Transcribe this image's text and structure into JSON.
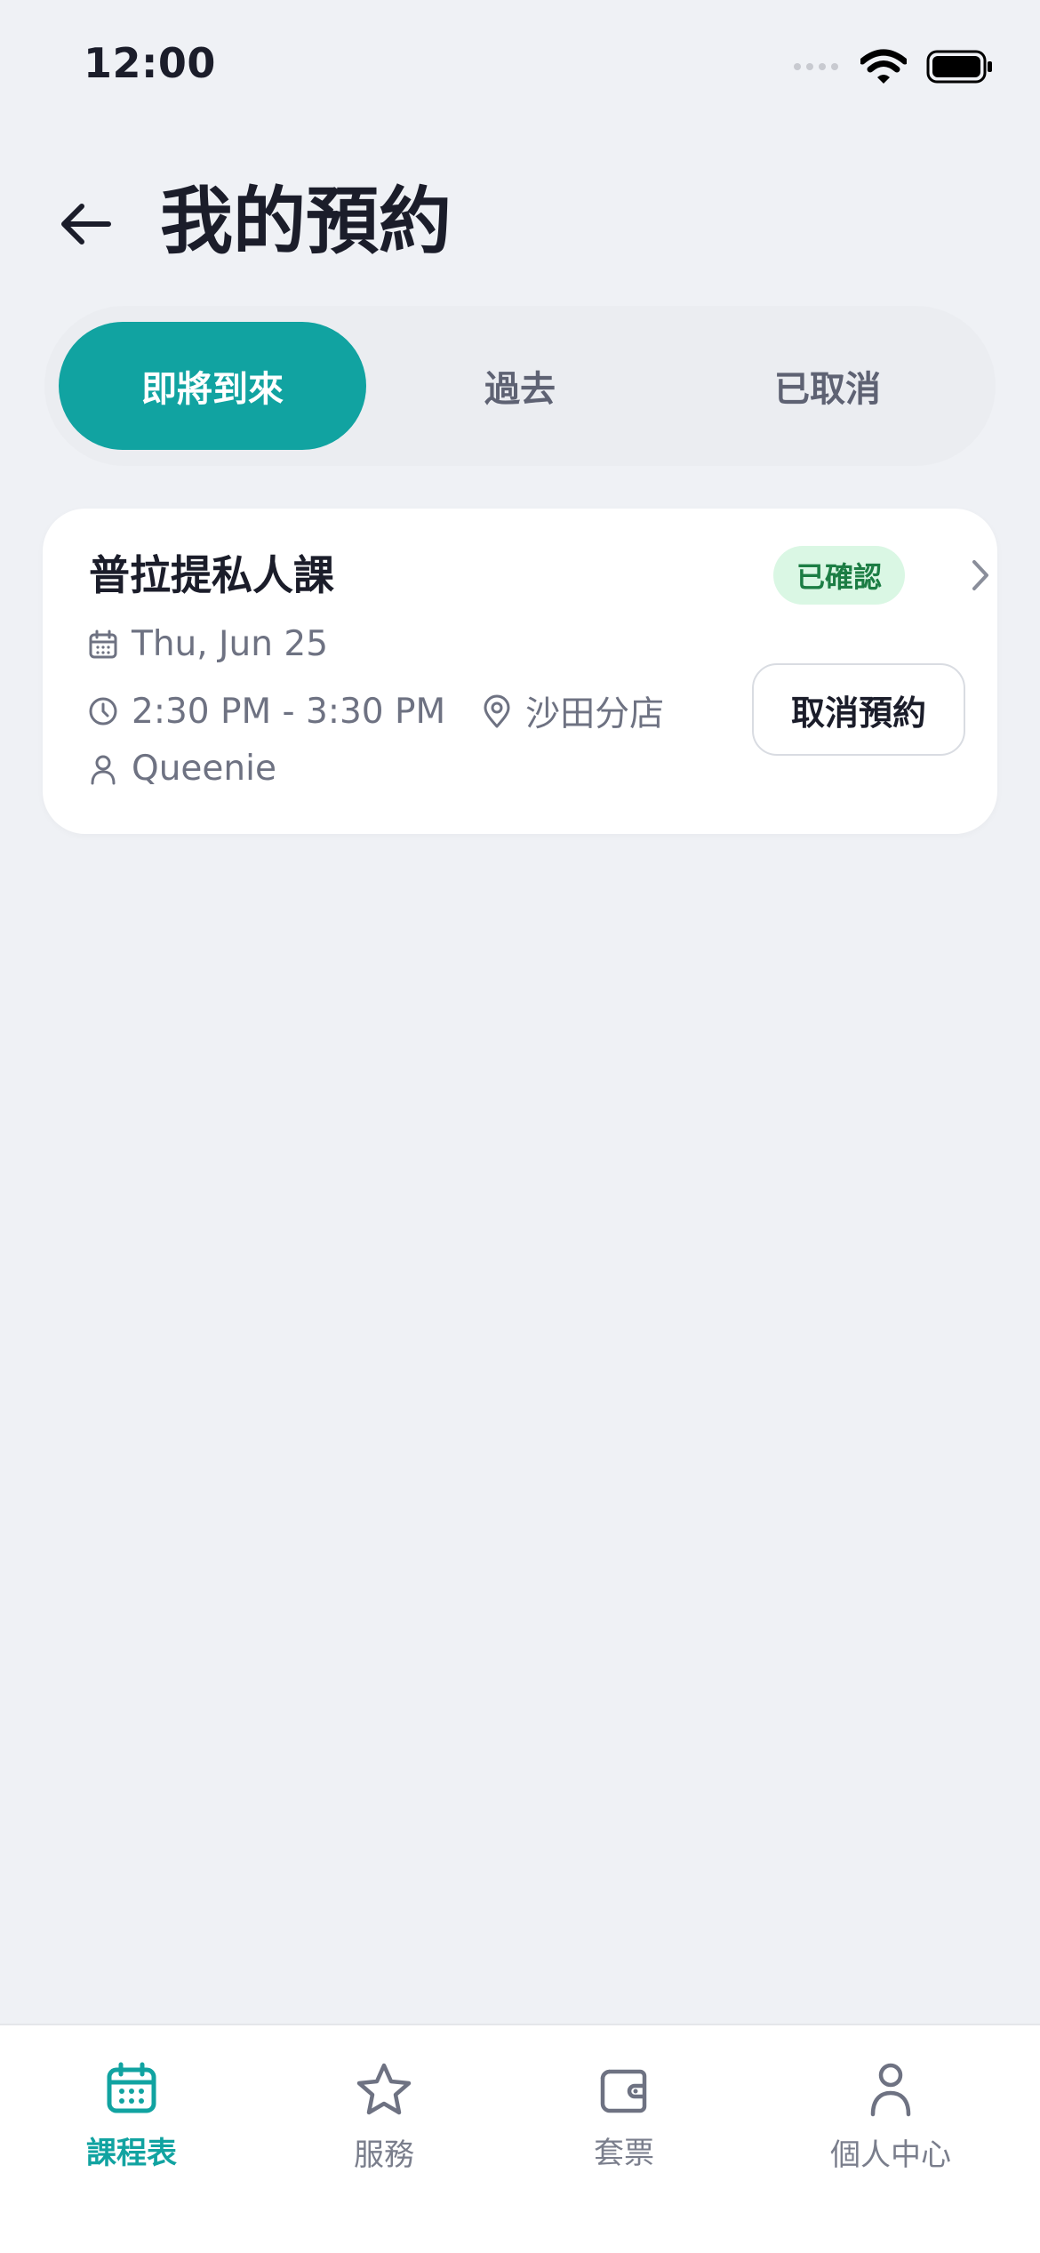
{
  "status_bar": {
    "time": "12:00"
  },
  "header": {
    "title": "我的預約"
  },
  "tabs": [
    {
      "label": "即將到來",
      "active": true
    },
    {
      "label": "過去",
      "active": false
    },
    {
      "label": "已取消",
      "active": false
    }
  ],
  "booking": {
    "title": "普拉提私人課",
    "status": "已確認",
    "date": "Thu, Jun 25",
    "time": "2:30 PM - 3:30 PM",
    "location": "沙田分店",
    "instructor": "Queenie",
    "cancel_label": "取消預約"
  },
  "bottom_nav": [
    {
      "label": "課程表",
      "icon": "calendar-icon",
      "active": true
    },
    {
      "label": "服務",
      "icon": "star-icon",
      "active": false
    },
    {
      "label": "套票",
      "icon": "wallet-icon",
      "active": false
    },
    {
      "label": "個人中心",
      "icon": "person-icon",
      "active": false
    }
  ],
  "colors": {
    "accent": "#11A3A1",
    "background": "#EFF1F5",
    "badge_bg": "#DAF7E4",
    "badge_text": "#1C7D44"
  }
}
